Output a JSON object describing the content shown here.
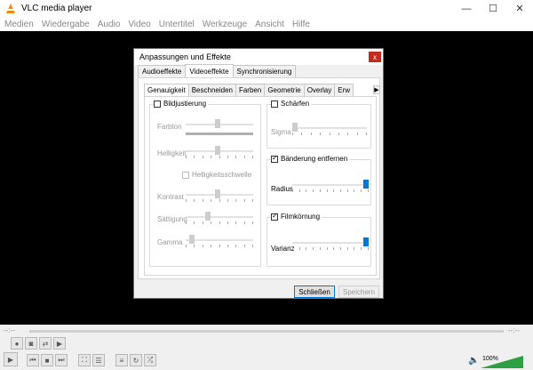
{
  "window": {
    "title": "VLC media player",
    "minimize": "—",
    "maximize": "☐",
    "close": "✕"
  },
  "menu": [
    "Medien",
    "Wiedergabe",
    "Audio",
    "Video",
    "Untertitel",
    "Werkzeuge",
    "Ansicht",
    "Hilfe"
  ],
  "dialog": {
    "title": "Anpassungen und Effekte",
    "close": "x",
    "tabs": [
      "Audioeffekte",
      "Videoeffekte",
      "Synchronisierung"
    ],
    "active_tab": "Videoeffekte",
    "subtabs": [
      "Genauigkeit",
      "Beschneiden",
      "Farben",
      "Geometrie",
      "Overlay",
      "Erw"
    ],
    "active_subtab": "Genauigkeit",
    "image_adjust": {
      "label": "Bildjustierung",
      "checked": false,
      "farbton": "Farbton",
      "helligkeit": "Helligkeit",
      "threshold": "Helligkeitsschwelle",
      "kontrast": "Kontrast",
      "saettigung": "Sättigung",
      "gamma": "Gamma"
    },
    "sharpen": {
      "label": "Schärfen",
      "checked": false,
      "sigma": "Sigma"
    },
    "banding": {
      "label": "Bänderung entfernen",
      "checked": true,
      "radius": "Radius"
    },
    "grain": {
      "label": "Filmkörnung",
      "checked": true,
      "varianz": "Varianz"
    },
    "close_button": "Schließen",
    "save_button": "Speichern"
  },
  "controls": {
    "time_left": "--:--",
    "time_right": "--:--",
    "volume": "100%"
  }
}
